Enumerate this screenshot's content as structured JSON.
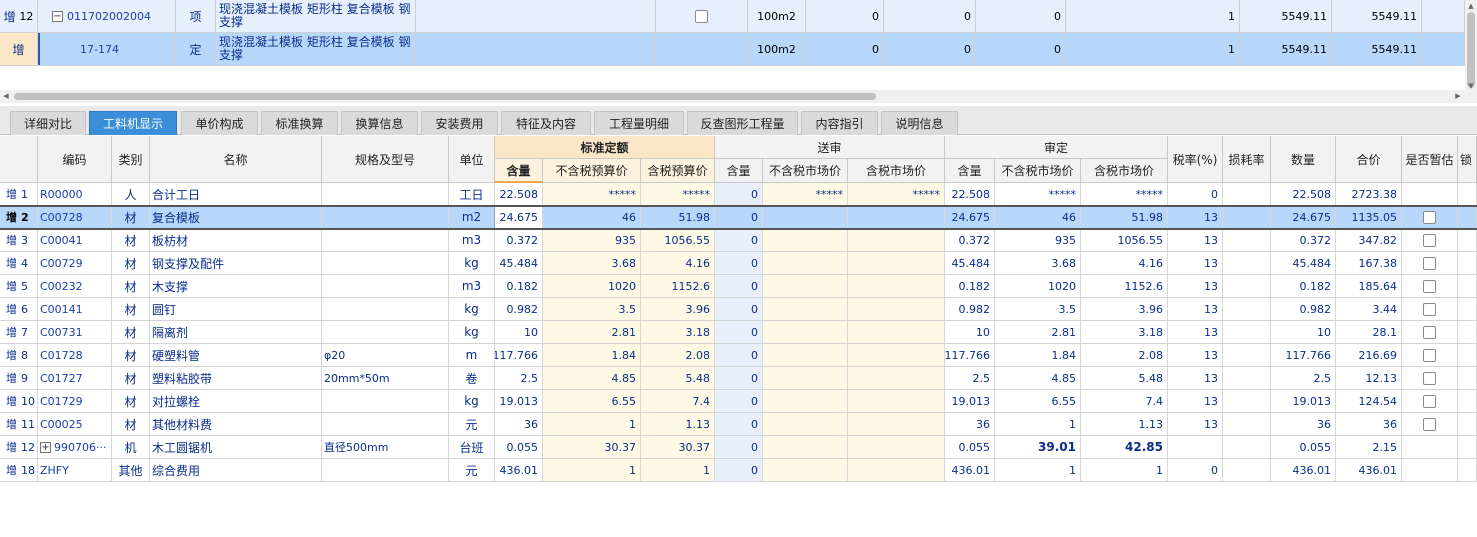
{
  "upper": {
    "rows": [
      {
        "action": "增",
        "level": "12",
        "code": "011702002004",
        "type": "项",
        "name": "现浇混凝土模板 矩形柱 复合模板 钢支撑",
        "unit": "100m2",
        "v1": "0",
        "v2": "0",
        "v3": "0",
        "qty": "1",
        "price": "5549.11",
        "total": "5549.11"
      },
      {
        "action": "增",
        "level": "",
        "code": "17-174",
        "type": "定",
        "name": "现浇混凝土模板 矩形柱 复合模板 钢支撑",
        "unit": "100m2",
        "v1": "0",
        "v2": "0",
        "v3": "0",
        "qty": "1",
        "price": "5549.11",
        "total": "5549.11"
      }
    ]
  },
  "tabs": [
    "详细对比",
    "工料机显示",
    "单价构成",
    "标准换算",
    "换算信息",
    "安装费用",
    "特征及内容",
    "工程量明细",
    "反查图形工程量",
    "内容指引",
    "说明信息"
  ],
  "active_tab": 1,
  "headers": {
    "code": "编码",
    "kind": "类别",
    "name": "名称",
    "spec": "规格及型号",
    "unit": "单位",
    "std_group": "标准定额",
    "std_qty": "含量",
    "std_notax": "不含税预算价",
    "std_tax": "含税预算价",
    "send_group": "送审",
    "send_qty": "含量",
    "send_notax": "不含税市场价",
    "send_tax": "含税市场价",
    "audit_group": "审定",
    "audit_qty": "含量",
    "audit_notax": "不含税市场价",
    "audit_tax": "含税市场价",
    "taxrate": "税率(%)",
    "loss": "损耗率",
    "count": "数量",
    "sum": "合价",
    "est": "是否暂估",
    "lock": "锁"
  },
  "rows": [
    {
      "act": "增",
      "no": "1",
      "code": "R00000",
      "kind": "人",
      "name": "合计工日",
      "spec": "",
      "unit": "工日",
      "sq": "22.508",
      "sn": "*****",
      "st": "*****",
      "dq": "0",
      "dn": "*****",
      "dt": "*****",
      "aq": "22.508",
      "an": "*****",
      "at": "*****",
      "tax": "0",
      "loss": "",
      "count": "22.508",
      "sum": "2723.38",
      "cb": false
    },
    {
      "act": "增",
      "no": "2",
      "code": "C00728",
      "kind": "材",
      "name": "复合模板",
      "spec": "",
      "unit": "m2",
      "sq": "24.675",
      "sn": "46",
      "st": "51.98",
      "dq": "0",
      "dn": "",
      "dt": "",
      "aq": "24.675",
      "an": "46",
      "at": "51.98",
      "tax": "13",
      "loss": "",
      "count": "24.675",
      "sum": "1135.05",
      "cb": true
    },
    {
      "act": "增",
      "no": "3",
      "code": "C00041",
      "kind": "材",
      "name": "板枋材",
      "spec": "",
      "unit": "m3",
      "sq": "0.372",
      "sn": "935",
      "st": "1056.55",
      "dq": "0",
      "dn": "",
      "dt": "",
      "aq": "0.372",
      "an": "935",
      "at": "1056.55",
      "tax": "13",
      "loss": "",
      "count": "0.372",
      "sum": "347.82",
      "cb": true
    },
    {
      "act": "增",
      "no": "4",
      "code": "C00729",
      "kind": "材",
      "name": "钢支撑及配件",
      "spec": "",
      "unit": "kg",
      "sq": "45.484",
      "sn": "3.68",
      "st": "4.16",
      "dq": "0",
      "dn": "",
      "dt": "",
      "aq": "45.484",
      "an": "3.68",
      "at": "4.16",
      "tax": "13",
      "loss": "",
      "count": "45.484",
      "sum": "167.38",
      "cb": true
    },
    {
      "act": "增",
      "no": "5",
      "code": "C00232",
      "kind": "材",
      "name": "木支撑",
      "spec": "",
      "unit": "m3",
      "sq": "0.182",
      "sn": "1020",
      "st": "1152.6",
      "dq": "0",
      "dn": "",
      "dt": "",
      "aq": "0.182",
      "an": "1020",
      "at": "1152.6",
      "tax": "13",
      "loss": "",
      "count": "0.182",
      "sum": "185.64",
      "cb": true
    },
    {
      "act": "增",
      "no": "6",
      "code": "C00141",
      "kind": "材",
      "name": "圆钉",
      "spec": "",
      "unit": "kg",
      "sq": "0.982",
      "sn": "3.5",
      "st": "3.96",
      "dq": "0",
      "dn": "",
      "dt": "",
      "aq": "0.982",
      "an": "3.5",
      "at": "3.96",
      "tax": "13",
      "loss": "",
      "count": "0.982",
      "sum": "3.44",
      "cb": true
    },
    {
      "act": "增",
      "no": "7",
      "code": "C00731",
      "kind": "材",
      "name": "隔离剂",
      "spec": "",
      "unit": "kg",
      "sq": "10",
      "sn": "2.81",
      "st": "3.18",
      "dq": "0",
      "dn": "",
      "dt": "",
      "aq": "10",
      "an": "2.81",
      "at": "3.18",
      "tax": "13",
      "loss": "",
      "count": "10",
      "sum": "28.1",
      "cb": true
    },
    {
      "act": "增",
      "no": "8",
      "code": "C01728",
      "kind": "材",
      "name": "硬塑料管",
      "spec": "φ20",
      "unit": "m",
      "sq": "117.766",
      "sn": "1.84",
      "st": "2.08",
      "dq": "0",
      "dn": "",
      "dt": "",
      "aq": "117.766",
      "an": "1.84",
      "at": "2.08",
      "tax": "13",
      "loss": "",
      "count": "117.766",
      "sum": "216.69",
      "cb": true
    },
    {
      "act": "增",
      "no": "9",
      "code": "C01727",
      "kind": "材",
      "name": "塑料粘胶带",
      "spec": "20mm*50m",
      "unit": "卷",
      "sq": "2.5",
      "sn": "4.85",
      "st": "5.48",
      "dq": "0",
      "dn": "",
      "dt": "",
      "aq": "2.5",
      "an": "4.85",
      "at": "5.48",
      "tax": "13",
      "loss": "",
      "count": "2.5",
      "sum": "12.13",
      "cb": true
    },
    {
      "act": "增",
      "no": "10",
      "code": "C01729",
      "kind": "材",
      "name": "对拉螺栓",
      "spec": "",
      "unit": "kg",
      "sq": "19.013",
      "sn": "6.55",
      "st": "7.4",
      "dq": "0",
      "dn": "",
      "dt": "",
      "aq": "19.013",
      "an": "6.55",
      "at": "7.4",
      "tax": "13",
      "loss": "",
      "count": "19.013",
      "sum": "124.54",
      "cb": true
    },
    {
      "act": "增",
      "no": "11",
      "code": "C00025",
      "kind": "材",
      "name": "其他材料费",
      "spec": "",
      "unit": "元",
      "sq": "36",
      "sn": "1",
      "st": "1.13",
      "dq": "0",
      "dn": "",
      "dt": "",
      "aq": "36",
      "an": "1",
      "at": "1.13",
      "tax": "13",
      "loss": "",
      "count": "36",
      "sum": "36",
      "cb": true
    },
    {
      "act": "增",
      "no": "12",
      "code": "990706···",
      "kind": "机",
      "name": "木工圆锯机",
      "spec": "直径500mm",
      "unit": "台班",
      "sq": "0.055",
      "sn": "30.37",
      "st": "30.37",
      "dq": "0",
      "dn": "",
      "dt": "",
      "aq": "0.055",
      "an": "39.01",
      "at": "42.85",
      "tax": "",
      "loss": "",
      "count": "0.055",
      "sum": "2.15",
      "cb": false,
      "expand": true,
      "bold": true
    },
    {
      "act": "增",
      "no": "18",
      "code": "ZHFY",
      "kind": "其他",
      "name": "综合费用",
      "spec": "",
      "unit": "元",
      "sq": "436.01",
      "sn": "1",
      "st": "1",
      "dq": "0",
      "dn": "",
      "dt": "",
      "aq": "436.01",
      "an": "1",
      "at": "1",
      "tax": "0",
      "loss": "",
      "count": "436.01",
      "sum": "436.01",
      "cb": false
    }
  ]
}
